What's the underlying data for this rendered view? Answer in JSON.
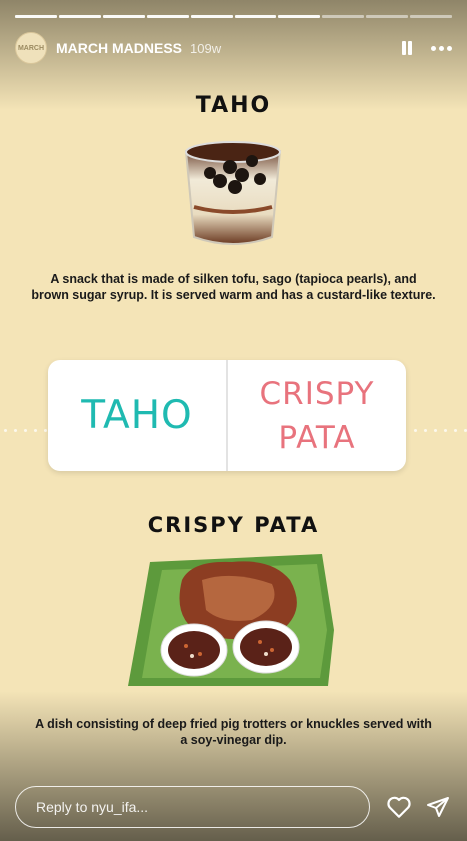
{
  "story": {
    "username": "MARCH MADNESS",
    "time_ago": "109w",
    "avatar_label": "MARCH",
    "segments_total": 10,
    "segments_done": 7
  },
  "content": {
    "taho": {
      "title": "TAHO",
      "description": "A snack that is made of silken tofu, sago (tapioca pearls), and brown sugar syrup. It is served warm and has a custard-like texture."
    },
    "poll": {
      "option_left": "TAHO",
      "option_right_line1": "CRISPY",
      "option_right_line2": "PATA"
    },
    "crispy_pata": {
      "title": "CRISPY PATA",
      "description": "A dish consisting of deep fried pig trotters or knuckles served with a soy-vinegar dip."
    }
  },
  "footer": {
    "reply_placeholder": "Reply to nyu_ifa..."
  },
  "colors": {
    "background": "#f4e4b7",
    "poll_left": "#1fbab1",
    "poll_right": "#e8737d"
  }
}
